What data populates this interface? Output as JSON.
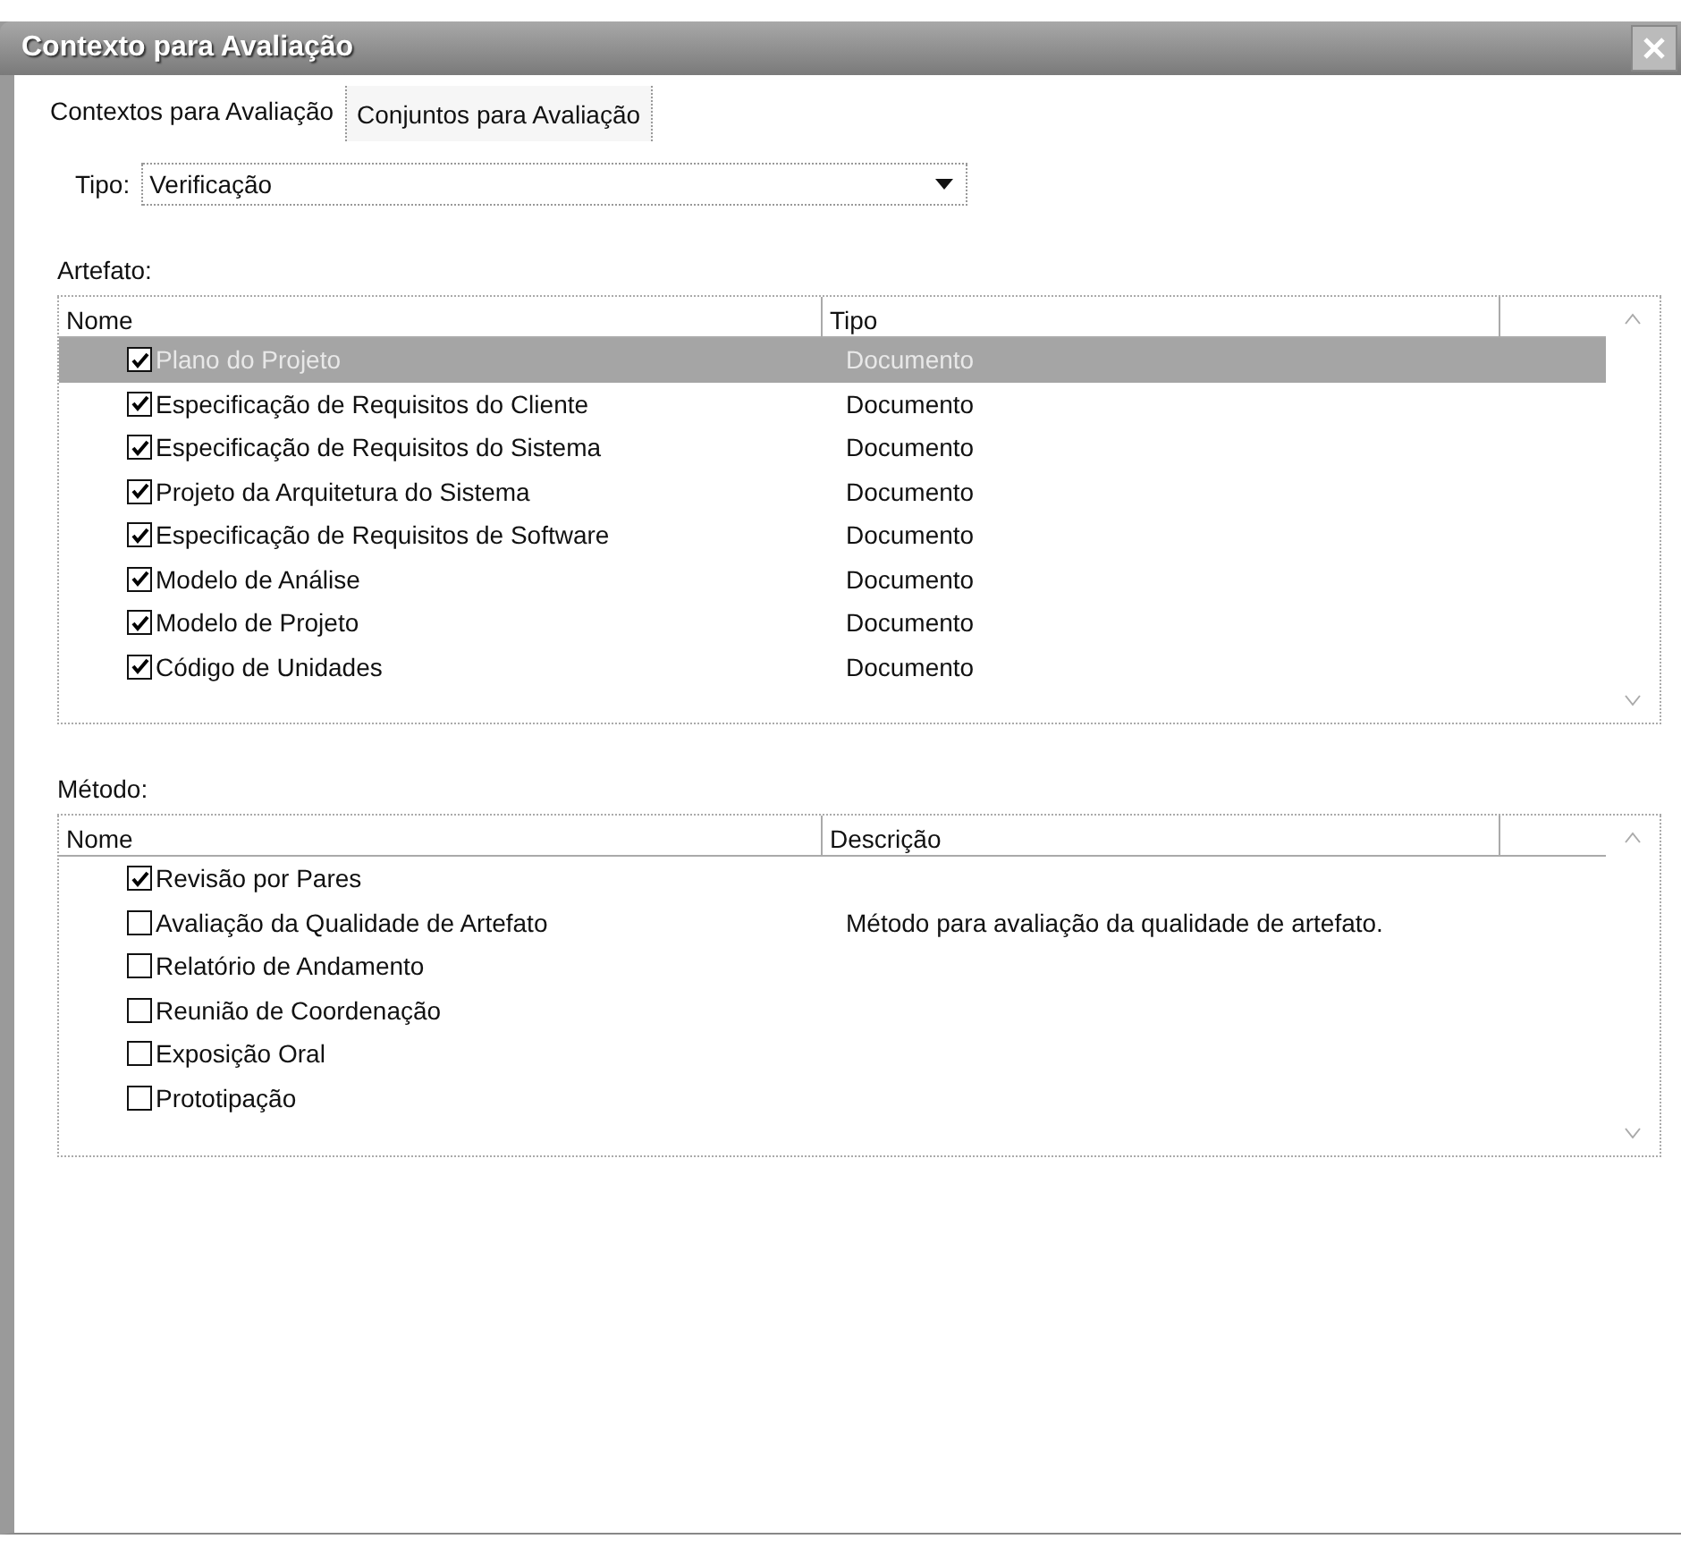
{
  "window": {
    "title": "Contexto para Avaliação"
  },
  "tabs": [
    {
      "label": "Contextos para Avaliação",
      "selected": true
    },
    {
      "label": "Conjuntos para Avaliação",
      "selected": false
    }
  ],
  "tipo": {
    "label": "Tipo:",
    "value": "Verificação"
  },
  "artefato": {
    "label": "Artefato:",
    "columns": [
      "Nome",
      "Tipo"
    ],
    "rows": [
      {
        "name": "Plano do Projeto",
        "tipo": "Documento",
        "checked": true,
        "selected": true
      },
      {
        "name": "Especificação de Requisitos do Cliente",
        "tipo": "Documento",
        "checked": true,
        "selected": false
      },
      {
        "name": "Especificação de Requisitos do Sistema",
        "tipo": "Documento",
        "checked": true,
        "selected": false
      },
      {
        "name": "Projeto da Arquitetura do Sistema",
        "tipo": "Documento",
        "checked": true,
        "selected": false
      },
      {
        "name": "Especificação de Requisitos de Software",
        "tipo": "Documento",
        "checked": true,
        "selected": false
      },
      {
        "name": "Modelo de Análise",
        "tipo": "Documento",
        "checked": true,
        "selected": false
      },
      {
        "name": "Modelo de Projeto",
        "tipo": "Documento",
        "checked": true,
        "selected": false
      },
      {
        "name": "Código de Unidades",
        "tipo": "Documento",
        "checked": true,
        "selected": false
      }
    ]
  },
  "metodo": {
    "label": "Método:",
    "columns": [
      "Nome",
      "Descrição"
    ],
    "rows": [
      {
        "name": "Revisão por Pares",
        "description": "",
        "checked": true
      },
      {
        "name": "Avaliação da Qualidade de Artefato",
        "description": "Método para avaliação da qualidade de artefato.",
        "checked": false
      },
      {
        "name": "Relatório de Andamento",
        "description": "",
        "checked": false
      },
      {
        "name": "Reunião de Coordenação",
        "description": "",
        "checked": false
      },
      {
        "name": "Exposição Oral",
        "description": "",
        "checked": false
      },
      {
        "name": "Prototipação",
        "description": "",
        "checked": false
      }
    ]
  }
}
